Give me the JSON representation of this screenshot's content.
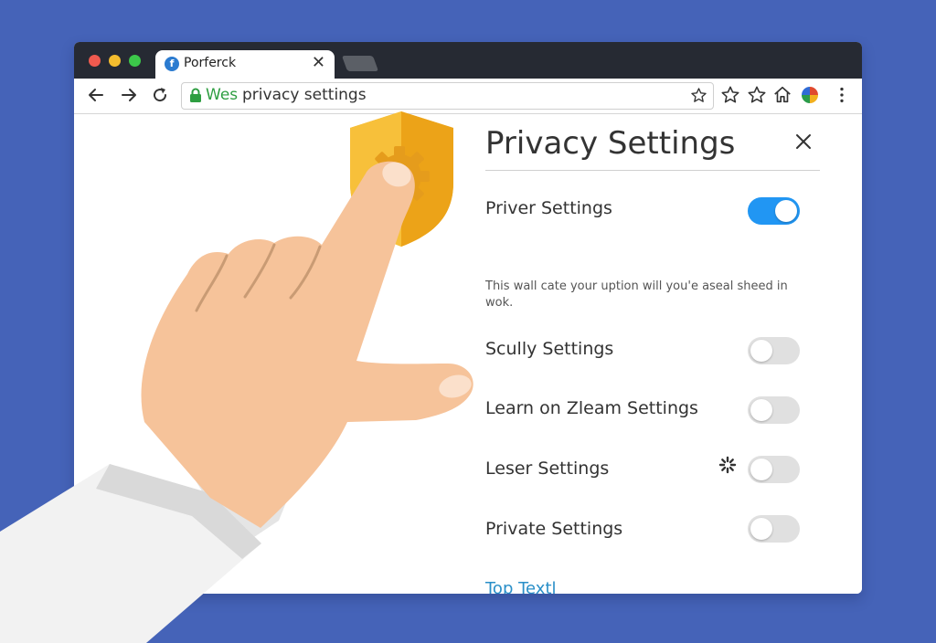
{
  "browser": {
    "tab": {
      "title": "Porferck",
      "favicon_letter": "f"
    },
    "address_bar": {
      "url_highlight": "Wes",
      "url_text": "privacy settings"
    },
    "icons": [
      "back-icon",
      "forward-icon",
      "reload-icon",
      "lock-icon",
      "star-icon",
      "bookmark-star-icon",
      "home-icon",
      "profile-avatar-icon",
      "menu-kebab-icon"
    ]
  },
  "settings": {
    "title": "Privacy Settings",
    "description": "This wall cate your uption will you'e aseal sheed in wok.",
    "rows": [
      {
        "label": "Priver Settings",
        "enabled": true
      },
      {
        "label": "Scully Settings",
        "enabled": false
      },
      {
        "label": "Learn on Zleam Settings",
        "enabled": false
      },
      {
        "label": "Leser Settings",
        "enabled": false
      },
      {
        "label": "Private Settings",
        "enabled": false
      }
    ],
    "footer_link": "Top Textl"
  },
  "colors": {
    "background": "#4563b8",
    "toggle_on": "#2196f3",
    "toggle_off": "#e0e0e0",
    "link": "#2a8fc8",
    "shield": "#f5b324",
    "secure_green": "#2e9e41"
  }
}
